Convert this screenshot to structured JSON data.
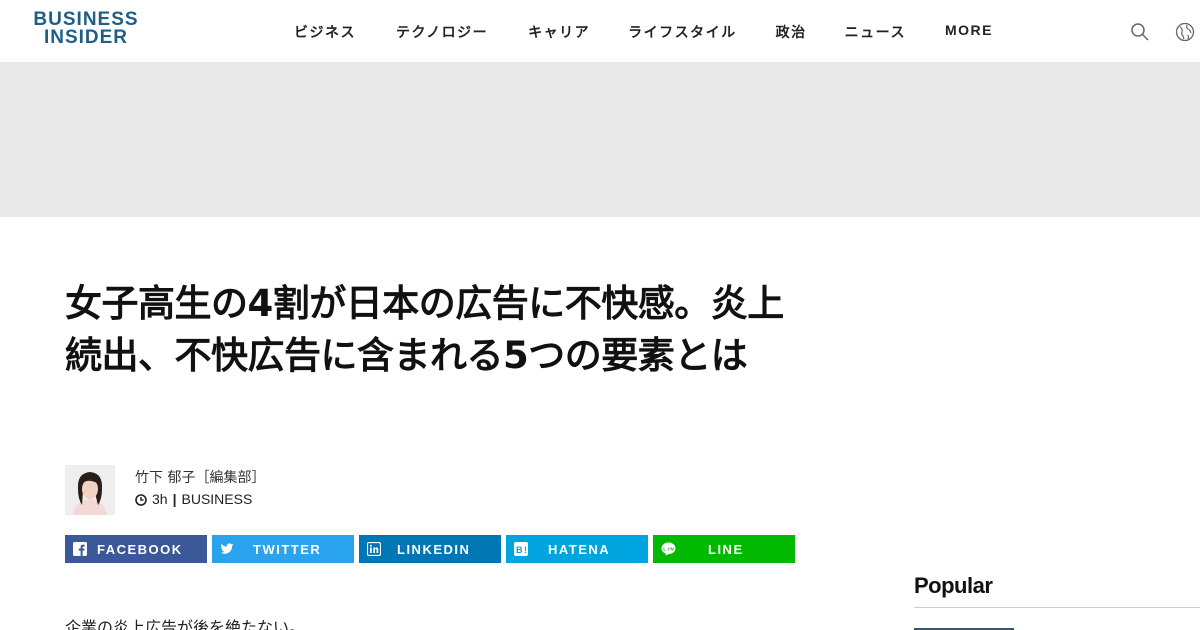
{
  "brand": {
    "line1": "BUSINESS",
    "line2": "INSIDER",
    "color": "#1f5f86"
  },
  "nav": {
    "items": [
      "ビジネス",
      "テクノロジー",
      "キャリア",
      "ライフスタイル",
      "政治",
      "ニュース",
      "MORE"
    ],
    "icons": [
      "search-icon",
      "globe-icon"
    ]
  },
  "article": {
    "title": "女子高生の4割が日本の広告に不快感。炎上続出、不快広告に含まれる5つの要素とは",
    "author": "竹下 郁子［編集部］",
    "time": "3h",
    "separator": "|",
    "category": "BUSINESS",
    "lead": "企業の炎上広告が後を絶たない。"
  },
  "share": [
    {
      "label": "FACEBOOK",
      "color": "#3b5998",
      "icon": "facebook-icon"
    },
    {
      "label": "TWITTER",
      "color": "#2aa3ef",
      "icon": "twitter-icon"
    },
    {
      "label": "LINKEDIN",
      "color": "#0077b5",
      "icon": "linkedin-icon"
    },
    {
      "label": "HATENA",
      "color": "#00a4de",
      "icon": "hatena-icon"
    },
    {
      "label": "LINE",
      "color": "#00b900",
      "icon": "line-icon"
    }
  ],
  "sidebar": {
    "popular_heading": "Popular"
  }
}
